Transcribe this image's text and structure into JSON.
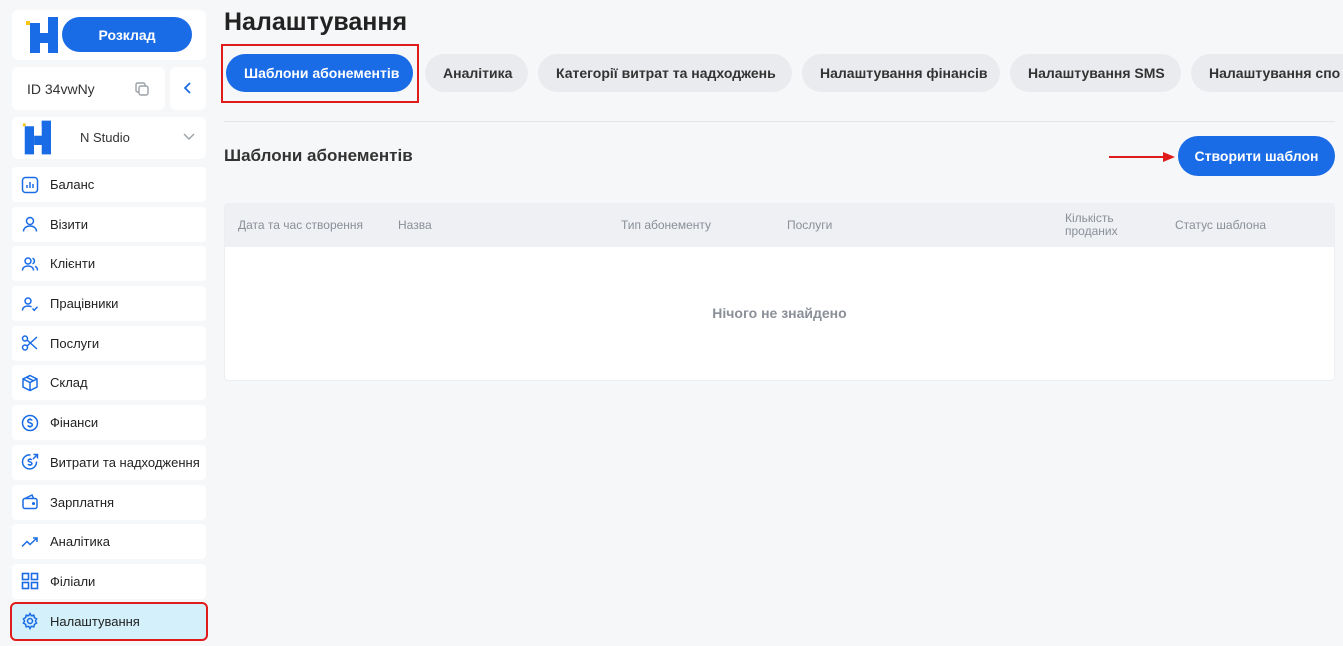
{
  "sidebar": {
    "schedule_button": "Розклад",
    "account_id": "ID 34vwNy",
    "studio_name": "N Studio",
    "menu": [
      {
        "label": "Баланс",
        "icon": "chart-bar-icon"
      },
      {
        "label": "Візити",
        "icon": "user-icon"
      },
      {
        "label": "Клієнти",
        "icon": "users-icon"
      },
      {
        "label": "Працівники",
        "icon": "user-check-icon"
      },
      {
        "label": "Послуги",
        "icon": "scissors-icon"
      },
      {
        "label": "Склад",
        "icon": "box-icon"
      },
      {
        "label": "Фінанси",
        "icon": "dollar-circle-icon"
      },
      {
        "label": "Витрати та надходження",
        "icon": "dollar-arrow-icon"
      },
      {
        "label": "Зарплатня",
        "icon": "wallet-icon"
      },
      {
        "label": "Аналітика",
        "icon": "trend-up-icon"
      },
      {
        "label": "Філіали",
        "icon": "grid-icon"
      },
      {
        "label": "Налаштування",
        "icon": "gear-icon",
        "active": true
      }
    ]
  },
  "main": {
    "title": "Налаштування",
    "tabs": [
      {
        "label": "Шаблони абонементів",
        "active": true
      },
      {
        "label": "Аналітика"
      },
      {
        "label": "Категорії витрат та надходжень"
      },
      {
        "label": "Налаштування фінансів"
      },
      {
        "label": "Налаштування SMS"
      },
      {
        "label": "Налаштування спо"
      }
    ],
    "section_title": "Шаблони абонементів",
    "create_button": "Створити шаблон",
    "table": {
      "columns": [
        "Дата та час створення",
        "Назва",
        "Тип абонементу",
        "Послуги",
        "Кількість проданих",
        "Статус шаблона"
      ],
      "empty_text": "Нічого не знайдено"
    }
  },
  "colors": {
    "accent": "#1a6ce6",
    "highlight_border": "#e01b1b",
    "active_menu_bg": "#d3f0fb",
    "logo_yellow": "#f5c518"
  }
}
